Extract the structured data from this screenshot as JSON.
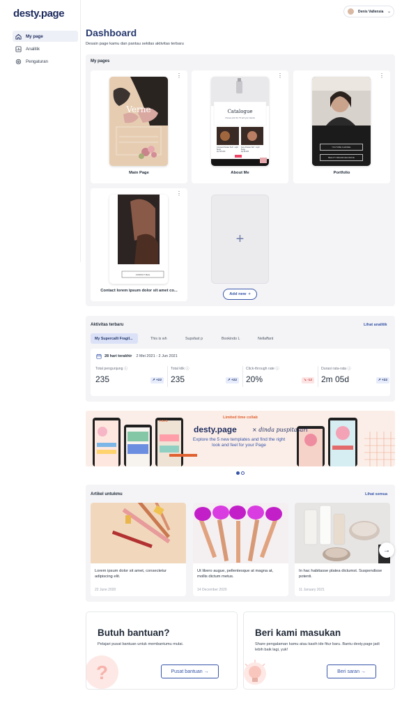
{
  "app": {
    "logo": "desty.page"
  },
  "sidebar": {
    "items": [
      {
        "label": "My page",
        "icon": "home-icon",
        "active": true
      },
      {
        "label": "Analitik",
        "icon": "bar-chart-icon",
        "active": false
      },
      {
        "label": "Pengaturan",
        "icon": "gear-icon",
        "active": false
      }
    ]
  },
  "user": {
    "name": "Denis Vallensia"
  },
  "header": {
    "title": "Dashboard",
    "subtitle": "Desain page kamu dan pantau sekilas aktivitas terbaru"
  },
  "my_pages": {
    "title": "My pages",
    "cards": [
      {
        "label": "Main Page",
        "phone_title": "Verne"
      },
      {
        "label": "About Me",
        "phone_title": "Catalogue",
        "phone_sub": "Choose pick this ?S with your dawzle",
        "product_1": "Compact Powder SLP - Light Beige",
        "price_1": "Rp 125.000",
        "product_2": "Face Powder SLP - Light Beige",
        "price_2": "Rp 89.000"
      },
      {
        "label": "Portfolio",
        "button_1": "YOUTUBE CHANNEL",
        "button_2": "BEAUTY BRAND DECORATE"
      },
      {
        "label": "Contact lorem ipsum dolor sit amet co...",
        "phone_title": "ARES FITNESS",
        "button_1": "CONTACT MAIL"
      }
    ],
    "add_new_label": "Add new"
  },
  "activity": {
    "title": "Aktivitas terbaru",
    "link": "Lihat analitik",
    "tabs": [
      "My Supercalli Fragil...",
      "This is wh",
      "Supsfast p",
      "Bookindo L",
      "Nellaffant"
    ],
    "range_label": "28 hari terakhir",
    "range_dates": "2 Mei 2021 - 2 Jun 2021",
    "stats": [
      {
        "label": "Total pengunjung",
        "value": "235",
        "delta": "+22",
        "positive": true
      },
      {
        "label": "Total klik",
        "value": "235",
        "delta": "+22",
        "positive": true
      },
      {
        "label": "Click-through rate",
        "value": "20%",
        "delta": "-12",
        "positive": false
      },
      {
        "label": "Durasi rata-rata",
        "value": "2m 05d",
        "delta": "+22",
        "positive": true
      }
    ]
  },
  "banner": {
    "tag": "Limited time collab",
    "brand": "desty.page",
    "partner": "× dinda puspitasari",
    "message": "Explore the 5 new templates and find the right look and feel for your Page",
    "phone_word": "POPO"
  },
  "articles": {
    "title": "Artikel untukmu",
    "link": "Lihat semua",
    "items": [
      {
        "text": "Lorem ipsum dolor sit amet, consectetur adipiscing elit.",
        "date": "22 June 2020"
      },
      {
        "text": "Ut libero augue, pellentesque at magna at, mollis dictum metus.",
        "date": "14 December 2020"
      },
      {
        "text": "In hac habitasse platea dictumst. Suspendisse potenti.",
        "date": "11 January 2021"
      }
    ]
  },
  "help": {
    "title": "Butuh bantuan?",
    "text": "Pelajari pusat bantuan untuk membantumu mulai.",
    "button": "Pusat bantuan →"
  },
  "feedback": {
    "title": "Beri kami masukan",
    "text": "Share pengalaman kamu atau kasih ide fitur baru. Bantu desty.page jadi lebih baik lagi, yuk!",
    "button": "Beri saran →"
  },
  "colors": {
    "brand": "#1d2b5e",
    "accent": "#3654a8",
    "promo": "#e0612f",
    "negative": "#c94b4b"
  }
}
